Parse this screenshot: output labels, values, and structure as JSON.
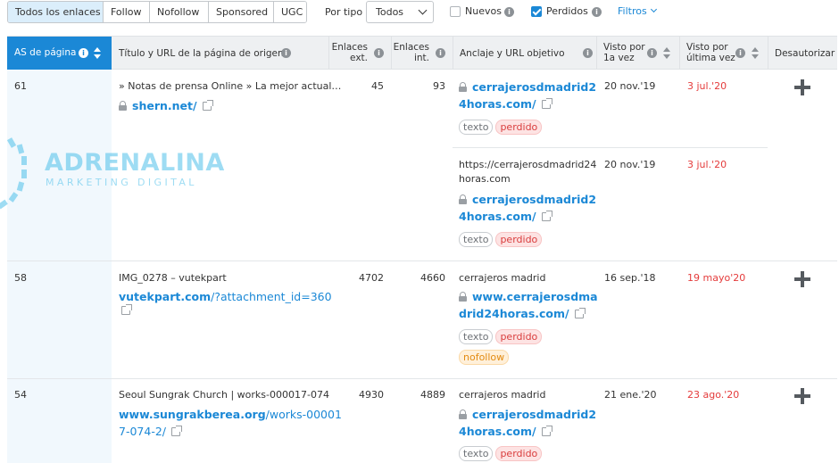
{
  "filters": {
    "link_types": [
      "Todos los enlaces",
      "Follow",
      "Nofollow",
      "Sponsored",
      "UGC"
    ],
    "active_link_type": "Todos los enlaces",
    "por_tipo_label": "Por tipo",
    "por_tipo_value": "Todos",
    "nuevos_label": "Nuevos",
    "nuevos_checked": false,
    "perdidos_label": "Perdidos",
    "perdidos_checked": true,
    "filtros_label": "Filtros"
  },
  "header": {
    "as": "AS de página",
    "title_url": "Título y URL de la página de origen",
    "ext_line1": "Enlaces",
    "ext_line2": "ext.",
    "int_line1": "Enlaces",
    "int_line2": "int.",
    "anchor": "Anclaje y URL objetivo",
    "first_seen_line1": "Visto por",
    "first_seen_line2": "1a vez",
    "last_seen_line1": "Visto por",
    "last_seen_line2": "última vez",
    "disavow": "Desautorizar"
  },
  "watermark": {
    "title": "ADRENALINA",
    "subtitle": "MARKETING DIGITAL"
  },
  "rows": [
    {
      "as": "61",
      "title": "» Notas de prensa Online » La mejor actual…",
      "source_domain": "shern.net/",
      "source_path": "",
      "ext": "45",
      "int": "93",
      "anchors": [
        {
          "anchor_text": "",
          "target_line1": "cerrajerosdmadrid2",
          "target_line2": "4horas.com/",
          "tags": [
            "texto",
            "perdido"
          ],
          "first_seen": "20 nov.'19",
          "last_seen": "3 jul.'20"
        },
        {
          "anchor_text_line1": "https://cerrajerosdmadrid24",
          "anchor_text_line2": "horas.com",
          "target_line1": "cerrajerosdmadrid2",
          "target_line2": "4horas.com/",
          "tags": [
            "texto",
            "perdido"
          ],
          "first_seen": "20 nov.'19",
          "last_seen": "3 jul.'20"
        }
      ]
    },
    {
      "as": "58",
      "title": "IMG_0278 – vutekpart",
      "source_domain": "vutekpart.com",
      "source_path": "/?attachment_id=360",
      "ext": "4702",
      "int": "4660",
      "anchor_text": "cerrajeros madrid",
      "target_line1": "www.cerrajerosdma",
      "target_line2": "drid24horas.com/",
      "tags": [
        "texto",
        "perdido",
        "nofollow"
      ],
      "first_seen": "16 sep.'18",
      "last_seen": "19 mayo'20"
    },
    {
      "as": "54",
      "title": "Seoul Sungrak Church | works-000017-074",
      "source_domain": "www.sungrakberea.org",
      "source_path_line1": "/works-00001",
      "source_path_line2": "7-074-2/",
      "ext": "4930",
      "int": "4889",
      "anchor_text": "cerrajeros madrid",
      "target_line1": "cerrajerosdmadrid2",
      "target_line2": "4horas.com/",
      "tags": [
        "texto",
        "perdido"
      ],
      "first_seen": "21 ene.'20",
      "last_seen": "23 ago.'20"
    }
  ],
  "colors": {
    "accent": "#1b88d6",
    "lost": "#e43b3b",
    "nofollow": "#e38b12"
  }
}
